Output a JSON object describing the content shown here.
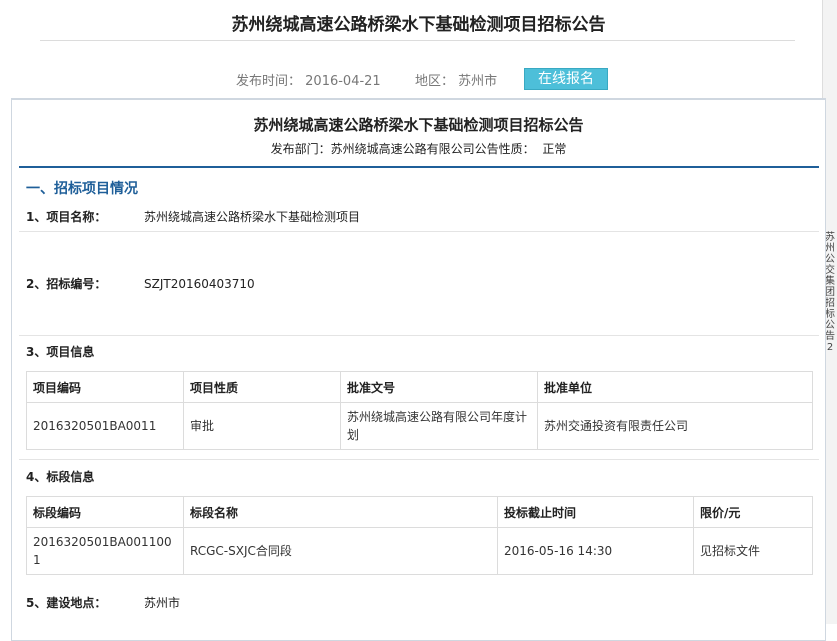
{
  "page": {
    "title": "苏州绕城高速公路桥梁水下基础检测项目招标公告",
    "publish_time_label": "发布时间：",
    "publish_time": "2016-04-21",
    "region_label": "地区：",
    "region": "苏州市",
    "online_signup_label": "在线报名"
  },
  "side": {
    "text": "苏州公交集团招标公告2"
  },
  "doc": {
    "title": "苏州绕城高速公路桥梁水下基础检测项目招标公告",
    "dept_label": "发布部门：",
    "dept": "苏州绕城高速公路有限公司",
    "nature_label": "公告性质：",
    "nature": "正常",
    "section1": "一、招标项目情况",
    "f1_label": "1、项目名称：",
    "f1_value": "苏州绕城高速公路桥梁水下基础检测项目",
    "f2_label": "2、招标编号：",
    "f2_value": "SZJT20160403710",
    "f3_label": "3、项目信息",
    "f4_label": "4、标段信息",
    "f5_label": "5、建设地点：",
    "f5_value": "苏州市"
  },
  "project_table": {
    "headers": [
      "项目编码",
      "项目性质",
      "批准文号",
      "批准单位"
    ],
    "row": [
      "2016320501BA0011",
      "审批",
      "苏州绕城高速公路有限公司年度计划",
      "苏州交通投资有限责任公司"
    ]
  },
  "section_table": {
    "headers": [
      "标段编码",
      "标段名称",
      "投标截止时间",
      "限价/元"
    ],
    "row": [
      "2016320501BA0011001",
      "RCGC-SXJC合同段",
      "2016-05-16 14:30",
      "见招标文件"
    ]
  },
  "colors": {
    "accent": "#1f5f99",
    "button": "#4dbfd9"
  }
}
